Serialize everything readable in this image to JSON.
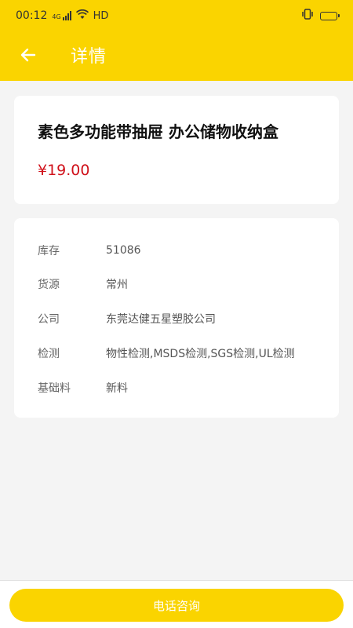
{
  "status_bar": {
    "time": "00:12",
    "network": "4G",
    "hd": "HD"
  },
  "nav": {
    "title": "详情"
  },
  "product": {
    "name": "素色多功能带抽屉 办公储物收纳盒",
    "price": "¥19.00"
  },
  "info": {
    "rows": [
      {
        "label": "库存",
        "value": "51086"
      },
      {
        "label": "货源",
        "value": "常州"
      },
      {
        "label": "公司",
        "value": "东莞达健五星塑胶公司"
      },
      {
        "label": "检测",
        "value": "物性检测,MSDS检测,SGS检测,UL检测"
      },
      {
        "label": "基础料",
        "value": "新料"
      }
    ]
  },
  "bottom": {
    "call_label": "电话咨询"
  },
  "colors": {
    "accent": "#fad400",
    "price": "#d0121b",
    "background": "#f4f4f4"
  },
  "icons": {
    "back": "arrow-left-icon",
    "wifi": "wifi-icon",
    "signal": "signal-icon",
    "battery": "battery-icon",
    "vibrate": "vibrate-icon"
  }
}
